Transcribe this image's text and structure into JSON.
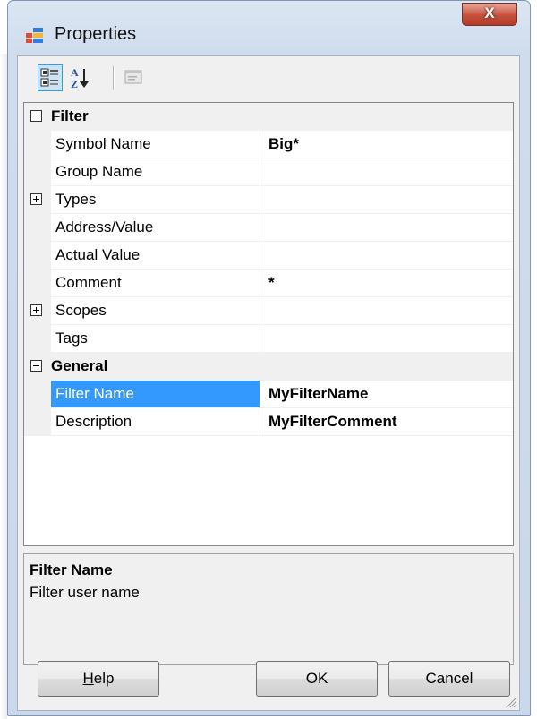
{
  "window": {
    "title": "Properties",
    "close_glyph": "X",
    "accent_color": "#3399ff"
  },
  "toolbar": {
    "buttons": [
      {
        "name": "categorized-view",
        "icon": "categorized-icon",
        "active": true
      },
      {
        "name": "alphabetical-view",
        "icon": "sort-az-icon",
        "active": false
      },
      {
        "name": "property-pages",
        "icon": "property-pages-icon",
        "active": false,
        "enabled": false
      }
    ]
  },
  "grid": {
    "categories": [
      {
        "label": "Filter",
        "expanded": true,
        "rows": [
          {
            "name": "Symbol Name",
            "value": "Big*"
          },
          {
            "name": "Group Name",
            "value": ""
          },
          {
            "name": "Types",
            "value": "",
            "expandable": true
          },
          {
            "name": "Address/Value",
            "value": ""
          },
          {
            "name": "Actual Value",
            "value": ""
          },
          {
            "name": "Comment",
            "value": "*"
          },
          {
            "name": "Scopes",
            "value": "",
            "expandable": true
          },
          {
            "name": "Tags",
            "value": ""
          }
        ]
      },
      {
        "label": "General",
        "expanded": true,
        "rows": [
          {
            "name": "Filter Name",
            "value": "MyFilterName",
            "selected": true
          },
          {
            "name": "Description",
            "value": "MyFilterComment"
          }
        ]
      }
    ]
  },
  "description": {
    "title": "Filter Name",
    "text": "Filter user name"
  },
  "buttons": {
    "help_mnemonic": "H",
    "help_rest": "elp",
    "ok": "OK",
    "cancel": "Cancel"
  }
}
